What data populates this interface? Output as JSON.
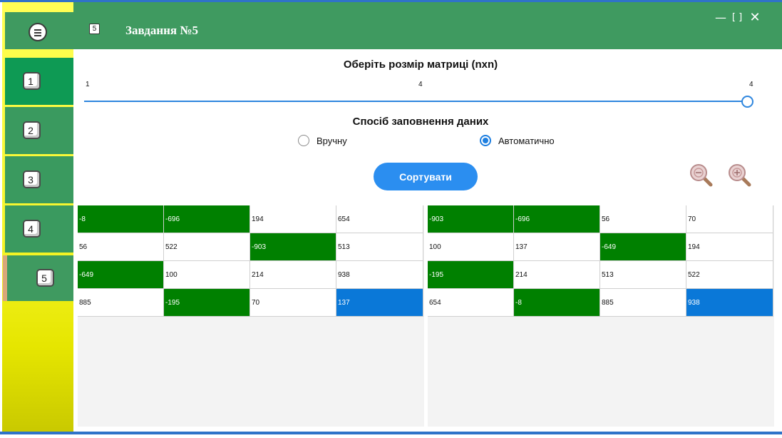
{
  "header": {
    "title": "Завдання №5",
    "icon_number": "5",
    "minimize_glyph": "—",
    "maximize_glyph": "[ ]",
    "close_glyph": "✕",
    "color": "#3f9a60"
  },
  "sidebar": {
    "menu_icon": "hamburger-circle-icon",
    "items": [
      {
        "label": "1"
      },
      {
        "label": "2"
      },
      {
        "label": "3"
      },
      {
        "label": "4"
      },
      {
        "label": "5"
      }
    ]
  },
  "matrix_size": {
    "title": "Оберіть розмір матриці (nxn)",
    "min_label": "1",
    "current_label": "4",
    "max_label": "4",
    "value": 4,
    "min": 1,
    "max": 4
  },
  "fill_mode": {
    "title": "Спосіб заповнення даних",
    "options": [
      {
        "label": "Вручну",
        "selected": false
      },
      {
        "label": "Автоматично",
        "selected": true
      }
    ]
  },
  "sort_button": {
    "label": "Сортувати",
    "color": "#2b8ef0"
  },
  "zoom": {
    "out_icon": "zoom-out-icon",
    "in_icon": "zoom-in-icon"
  },
  "colors": {
    "highlight_green": "#008000",
    "highlight_blue": "#0a78d8",
    "slider": "#2e86de"
  },
  "input_grid": {
    "rows": [
      [
        {
          "v": "-8",
          "c": "g"
        },
        {
          "v": "-696",
          "c": "g"
        },
        {
          "v": "194",
          "c": ""
        },
        {
          "v": "654",
          "c": ""
        }
      ],
      [
        {
          "v": "56",
          "c": ""
        },
        {
          "v": "522",
          "c": ""
        },
        {
          "v": "-903",
          "c": "g"
        },
        {
          "v": "513",
          "c": ""
        }
      ],
      [
        {
          "v": "-649",
          "c": "g"
        },
        {
          "v": "100",
          "c": ""
        },
        {
          "v": "214",
          "c": ""
        },
        {
          "v": "938",
          "c": ""
        }
      ],
      [
        {
          "v": "885",
          "c": ""
        },
        {
          "v": "-195",
          "c": "g"
        },
        {
          "v": "70",
          "c": ""
        },
        {
          "v": "137",
          "c": "b"
        }
      ]
    ]
  },
  "output_grid": {
    "rows": [
      [
        {
          "v": "-903",
          "c": "g"
        },
        {
          "v": "-696",
          "c": "g"
        },
        {
          "v": "56",
          "c": ""
        },
        {
          "v": "70",
          "c": ""
        }
      ],
      [
        {
          "v": "100",
          "c": ""
        },
        {
          "v": "137",
          "c": ""
        },
        {
          "v": "-649",
          "c": "g"
        },
        {
          "v": "194",
          "c": ""
        }
      ],
      [
        {
          "v": "-195",
          "c": "g"
        },
        {
          "v": "214",
          "c": ""
        },
        {
          "v": "513",
          "c": ""
        },
        {
          "v": "522",
          "c": ""
        }
      ],
      [
        {
          "v": "654",
          "c": ""
        },
        {
          "v": "-8",
          "c": "g"
        },
        {
          "v": "885",
          "c": ""
        },
        {
          "v": "938",
          "c": "b"
        }
      ]
    ]
  }
}
